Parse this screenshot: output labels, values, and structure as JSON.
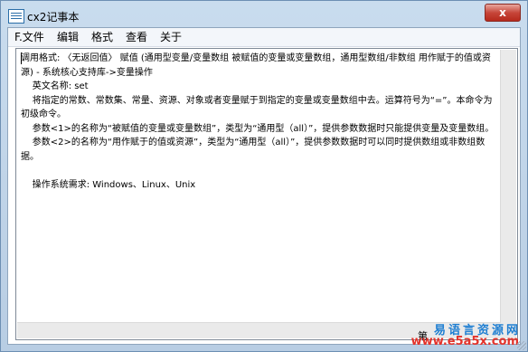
{
  "window": {
    "title": "cx2记事本",
    "close_label": "x",
    "app_icon": "notepad-icon"
  },
  "menu": {
    "items": [
      {
        "label": "F.文件"
      },
      {
        "label": "编辑"
      },
      {
        "label": "格式"
      },
      {
        "label": "查看"
      },
      {
        "label": "关于"
      }
    ]
  },
  "editor": {
    "content": "调用格式: 〈无返回值〉 赋值 (通用型变量/变量数组 被赋值的变量或变量数组，通用型数组/非数组 用作赋于的值或资源) - 系统核心支持库->变量操作\n    英文名称: set\n    将指定的常数、常数集、常量、资源、对象或者变量赋于到指定的变量或变量数组中去。运算符号为“=”。本命令为初级命令。\n    参数<1>的名称为“被赋值的变量或变量数组”，类型为“通用型（all）”，提供参数数据时只能提供变量及变量数组。\n    参数<2>的名称为“用作赋于的值或资源”，类型为“通用型（all）”，提供参数数据时可以同时提供数组或非数组数据。\n\n    操作系统需求: Windows、Linux、Unix"
  },
  "status": {
    "text": "第"
  },
  "watermark": {
    "cn": "易语言资源网",
    "en": "www.e5a5x.com"
  },
  "colors": {
    "frame": "#c9dcee",
    "close_button": "#c7463a",
    "watermark_blue": "#1f7fd2",
    "watermark_red": "#e3332b"
  }
}
